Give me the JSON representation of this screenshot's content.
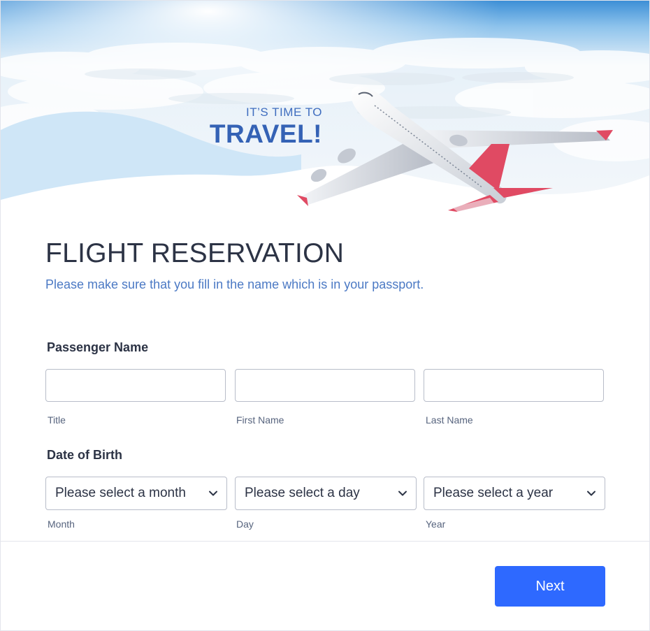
{
  "hero": {
    "tagline_small": "IT’S TIME TO",
    "tagline_big": "TRAVEL!"
  },
  "form": {
    "title": "FLIGHT RESERVATION",
    "subtitle": "Please make sure that you fill in the name which is in your passport."
  },
  "passenger_name": {
    "label": "Passenger Name",
    "title_field": {
      "value": "",
      "sublabel": "Title"
    },
    "first_name_field": {
      "value": "",
      "sublabel": "First Name"
    },
    "last_name_field": {
      "value": "",
      "sublabel": "Last Name"
    }
  },
  "date_of_birth": {
    "label": "Date of Birth",
    "month": {
      "selected": "Please select a month",
      "sublabel": "Month"
    },
    "day": {
      "selected": "Please select a day",
      "sublabel": "Day"
    },
    "year": {
      "selected": "Please select a year",
      "sublabel": "Year"
    }
  },
  "footer": {
    "next_label": "Next"
  },
  "colors": {
    "accent": "#2e69ff",
    "title_blue": "#3462b5",
    "subtitle_blue": "#4b79c4",
    "airplane_tail": "#e04a63"
  },
  "icons": {
    "dropdown": "chevron-down-icon",
    "hero_image": "airplane-icon"
  }
}
